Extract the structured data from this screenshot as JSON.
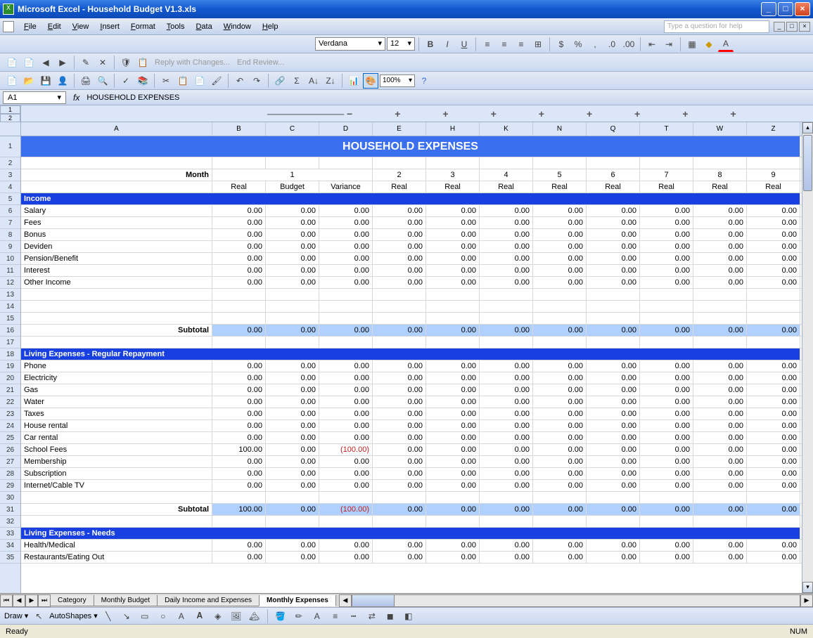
{
  "window": {
    "title": "Microsoft Excel - Household Budget V1.3.xls",
    "help_placeholder": "Type a question for help"
  },
  "menus": [
    "File",
    "Edit",
    "View",
    "Insert",
    "Format",
    "Tools",
    "Data",
    "Window",
    "Help"
  ],
  "format_bar": {
    "font": "Verdana",
    "size": "12"
  },
  "zoom": "100%",
  "namebox": "A1",
  "formula": "HOUSEHOLD EXPENSES",
  "columns": [
    "A",
    "B",
    "C",
    "D",
    "E",
    "H",
    "K",
    "N",
    "Q",
    "T",
    "W",
    "Z"
  ],
  "row_numbers": [
    "1",
    "2",
    "3",
    "4",
    "5",
    "6",
    "7",
    "8",
    "9",
    "10",
    "11",
    "12",
    "13",
    "14",
    "15",
    "16",
    "17",
    "18",
    "19",
    "20",
    "21",
    "22",
    "23",
    "24",
    "25",
    "26",
    "27",
    "28",
    "29",
    "30",
    "31",
    "32",
    "33",
    "34",
    "35"
  ],
  "sheet": {
    "title": "HOUSEHOLD EXPENSES",
    "month_label": "Month",
    "months": [
      "1",
      "",
      "",
      "2",
      "3",
      "4",
      "5",
      "6",
      "7",
      "8",
      "9"
    ],
    "subheaders": [
      "Real",
      "Budget",
      "Variance",
      "Real",
      "Real",
      "Real",
      "Real",
      "Real",
      "Real",
      "Real",
      "Real"
    ],
    "section1": "Income",
    "income_rows": [
      {
        "label": "Salary",
        "vals": [
          "0.00",
          "0.00",
          "0.00",
          "0.00",
          "0.00",
          "0.00",
          "0.00",
          "0.00",
          "0.00",
          "0.00",
          "0.00"
        ]
      },
      {
        "label": "Fees",
        "vals": [
          "0.00",
          "0.00",
          "0.00",
          "0.00",
          "0.00",
          "0.00",
          "0.00",
          "0.00",
          "0.00",
          "0.00",
          "0.00"
        ]
      },
      {
        "label": "Bonus",
        "vals": [
          "0.00",
          "0.00",
          "0.00",
          "0.00",
          "0.00",
          "0.00",
          "0.00",
          "0.00",
          "0.00",
          "0.00",
          "0.00"
        ]
      },
      {
        "label": "Deviden",
        "vals": [
          "0.00",
          "0.00",
          "0.00",
          "0.00",
          "0.00",
          "0.00",
          "0.00",
          "0.00",
          "0.00",
          "0.00",
          "0.00"
        ]
      },
      {
        "label": "Pension/Benefit",
        "vals": [
          "0.00",
          "0.00",
          "0.00",
          "0.00",
          "0.00",
          "0.00",
          "0.00",
          "0.00",
          "0.00",
          "0.00",
          "0.00"
        ]
      },
      {
        "label": "Interest",
        "vals": [
          "0.00",
          "0.00",
          "0.00",
          "0.00",
          "0.00",
          "0.00",
          "0.00",
          "0.00",
          "0.00",
          "0.00",
          "0.00"
        ]
      },
      {
        "label": "Other Income",
        "vals": [
          "0.00",
          "0.00",
          "0.00",
          "0.00",
          "0.00",
          "0.00",
          "0.00",
          "0.00",
          "0.00",
          "0.00",
          "0.00"
        ]
      }
    ],
    "subtotal_label": "Subtotal",
    "subtotal1": [
      "0.00",
      "0.00",
      "0.00",
      "0.00",
      "0.00",
      "0.00",
      "0.00",
      "0.00",
      "0.00",
      "0.00",
      "0.00"
    ],
    "section2": "Living Expenses - Regular Repayment",
    "living_rows": [
      {
        "label": "Phone",
        "vals": [
          "0.00",
          "0.00",
          "0.00",
          "0.00",
          "0.00",
          "0.00",
          "0.00",
          "0.00",
          "0.00",
          "0.00",
          "0.00"
        ]
      },
      {
        "label": "Electricity",
        "vals": [
          "0.00",
          "0.00",
          "0.00",
          "0.00",
          "0.00",
          "0.00",
          "0.00",
          "0.00",
          "0.00",
          "0.00",
          "0.00"
        ]
      },
      {
        "label": "Gas",
        "vals": [
          "0.00",
          "0.00",
          "0.00",
          "0.00",
          "0.00",
          "0.00",
          "0.00",
          "0.00",
          "0.00",
          "0.00",
          "0.00"
        ]
      },
      {
        "label": "Water",
        "vals": [
          "0.00",
          "0.00",
          "0.00",
          "0.00",
          "0.00",
          "0.00",
          "0.00",
          "0.00",
          "0.00",
          "0.00",
          "0.00"
        ]
      },
      {
        "label": "Taxes",
        "vals": [
          "0.00",
          "0.00",
          "0.00",
          "0.00",
          "0.00",
          "0.00",
          "0.00",
          "0.00",
          "0.00",
          "0.00",
          "0.00"
        ]
      },
      {
        "label": "House rental",
        "vals": [
          "0.00",
          "0.00",
          "0.00",
          "0.00",
          "0.00",
          "0.00",
          "0.00",
          "0.00",
          "0.00",
          "0.00",
          "0.00"
        ]
      },
      {
        "label": "Car rental",
        "vals": [
          "0.00",
          "0.00",
          "0.00",
          "0.00",
          "0.00",
          "0.00",
          "0.00",
          "0.00",
          "0.00",
          "0.00",
          "0.00"
        ]
      },
      {
        "label": "School Fees",
        "vals": [
          "100.00",
          "0.00",
          "(100.00)",
          "0.00",
          "0.00",
          "0.00",
          "0.00",
          "0.00",
          "0.00",
          "0.00",
          "0.00"
        ]
      },
      {
        "label": "Membership",
        "vals": [
          "0.00",
          "0.00",
          "0.00",
          "0.00",
          "0.00",
          "0.00",
          "0.00",
          "0.00",
          "0.00",
          "0.00",
          "0.00"
        ]
      },
      {
        "label": "Subscription",
        "vals": [
          "0.00",
          "0.00",
          "0.00",
          "0.00",
          "0.00",
          "0.00",
          "0.00",
          "0.00",
          "0.00",
          "0.00",
          "0.00"
        ]
      },
      {
        "label": "Internet/Cable TV",
        "vals": [
          "0.00",
          "0.00",
          "0.00",
          "0.00",
          "0.00",
          "0.00",
          "0.00",
          "0.00",
          "0.00",
          "0.00",
          "0.00"
        ]
      }
    ],
    "subtotal2": [
      "100.00",
      "0.00",
      "(100.00)",
      "0.00",
      "0.00",
      "0.00",
      "0.00",
      "0.00",
      "0.00",
      "0.00",
      "0.00"
    ],
    "section3": "Living Expenses - Needs",
    "needs_rows": [
      {
        "label": "Health/Medical",
        "vals": [
          "0.00",
          "0.00",
          "0.00",
          "0.00",
          "0.00",
          "0.00",
          "0.00",
          "0.00",
          "0.00",
          "0.00",
          "0.00"
        ]
      },
      {
        "label": "Restaurants/Eating Out",
        "vals": [
          "0.00",
          "0.00",
          "0.00",
          "0.00",
          "0.00",
          "0.00",
          "0.00",
          "0.00",
          "0.00",
          "0.00",
          "0.00"
        ]
      }
    ]
  },
  "tabs": [
    "Category",
    "Monthly Budget",
    "Daily Income and Expenses",
    "Monthly Expenses"
  ],
  "active_tab": 3,
  "draw_label": "Draw",
  "autoshapes_label": "AutoShapes",
  "status": {
    "ready": "Ready",
    "num": "NUM"
  }
}
